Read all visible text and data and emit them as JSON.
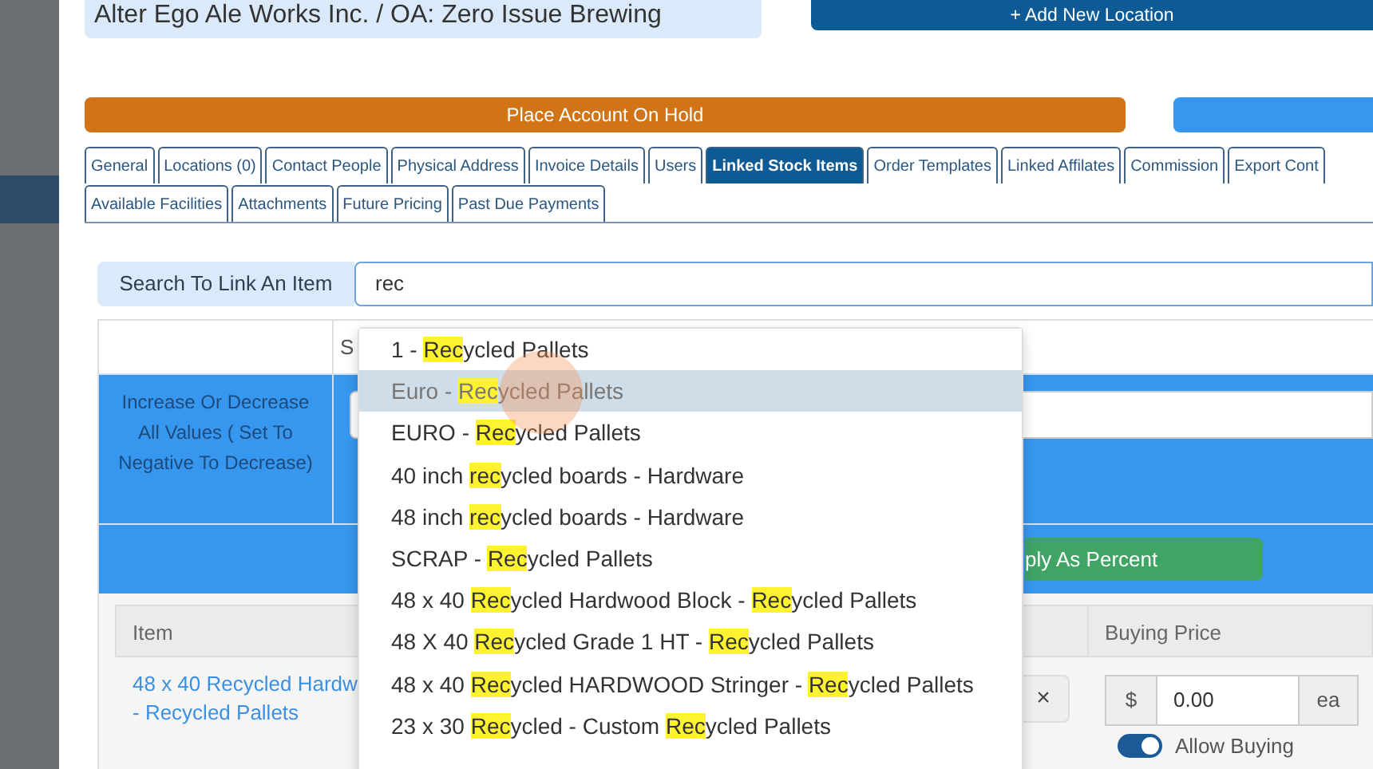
{
  "header": {
    "account_name": "Alter Ego Ale Works Inc. / OA: Zero Issue Brewing",
    "add_location_button": "+ Add New Location",
    "hold_button": "Place Account On Hold"
  },
  "tab_rows": [
    [
      {
        "label": "General",
        "selected": false
      },
      {
        "label": "Locations (0)",
        "selected": false
      },
      {
        "label": "Contact People",
        "selected": false
      },
      {
        "label": "Physical Address",
        "selected": false
      },
      {
        "label": "Invoice Details",
        "selected": false
      },
      {
        "label": "Users",
        "selected": false
      },
      {
        "label": "Linked Stock Items",
        "selected": true
      },
      {
        "label": "Order Templates",
        "selected": false
      },
      {
        "label": "Linked Affilates",
        "selected": false
      },
      {
        "label": "Commission",
        "selected": false
      },
      {
        "label": "Export Cont",
        "selected": false
      }
    ],
    [
      {
        "label": "Available Facilities",
        "selected": false
      },
      {
        "label": "Attachments",
        "selected": false
      },
      {
        "label": "Future Pricing",
        "selected": false
      },
      {
        "label": "Past Due Payments",
        "selected": false
      }
    ]
  ],
  "search": {
    "label": "Search To Link An Item",
    "value": "rec"
  },
  "bulk_table": {
    "column_2": "S",
    "adjust_label": "Increase Or Decrease All Values ( Set To Negative To Decrease)",
    "apply_button": "ply As Percent"
  },
  "items_table": {
    "columns": [
      "Item",
      "Buying Price"
    ],
    "rows": [
      {
        "item": "48 x 40 Recycled Hardw",
        "item_line_2": "- Recycled Pallets",
        "remove": "×",
        "currency": "$",
        "price": "0.00",
        "unit": "ea",
        "allow_buying": {
          "label": "Allow Buying",
          "on": true
        }
      }
    ]
  },
  "suggestions": [
    {
      "selected": false,
      "parts": [
        {
          "text": "1 - "
        },
        {
          "text": "Rec",
          "match": true
        },
        {
          "text": "ycled Pallets"
        }
      ]
    },
    {
      "selected": true,
      "parts": [
        {
          "text": "Euro - "
        },
        {
          "text": "Rec",
          "match": true
        },
        {
          "text": "ycled Pallets"
        }
      ]
    },
    {
      "selected": false,
      "parts": [
        {
          "text": "EURO - "
        },
        {
          "text": "Rec",
          "match": true
        },
        {
          "text": "ycled Pallets"
        }
      ]
    },
    {
      "selected": false,
      "parts": [
        {
          "text": "40 inch "
        },
        {
          "text": "rec",
          "match": true
        },
        {
          "text": "ycled boards - Hardware"
        }
      ]
    },
    {
      "selected": false,
      "parts": [
        {
          "text": "48 inch "
        },
        {
          "text": "rec",
          "match": true
        },
        {
          "text": "ycled boards - Hardware"
        }
      ]
    },
    {
      "selected": false,
      "parts": [
        {
          "text": "SCRAP - "
        },
        {
          "text": "Rec",
          "match": true
        },
        {
          "text": "ycled Pallets"
        }
      ]
    },
    {
      "selected": false,
      "parts": [
        {
          "text": "48 x 40 "
        },
        {
          "text": "Rec",
          "match": true
        },
        {
          "text": "ycled Hardwood Block - "
        },
        {
          "text": "Rec",
          "match": true
        },
        {
          "text": "ycled Pallets"
        }
      ]
    },
    {
      "selected": false,
      "parts": [
        {
          "text": "48 X 40 "
        },
        {
          "text": "Rec",
          "match": true
        },
        {
          "text": "ycled Grade 1 HT - "
        },
        {
          "text": "Rec",
          "match": true
        },
        {
          "text": "ycled Pallets"
        }
      ]
    },
    {
      "selected": false,
      "parts": [
        {
          "text": "48 x 40 "
        },
        {
          "text": "Rec",
          "match": true
        },
        {
          "text": "ycled HARDWOOD Stringer - "
        },
        {
          "text": "Rec",
          "match": true
        },
        {
          "text": "ycled Pallets"
        }
      ]
    },
    {
      "selected": false,
      "parts": [
        {
          "text": "23 x 30 "
        },
        {
          "text": "Rec",
          "match": true
        },
        {
          "text": "ycled - Custom "
        },
        {
          "text": "Rec",
          "match": true
        },
        {
          "text": "ycled Pallets"
        }
      ]
    }
  ]
}
